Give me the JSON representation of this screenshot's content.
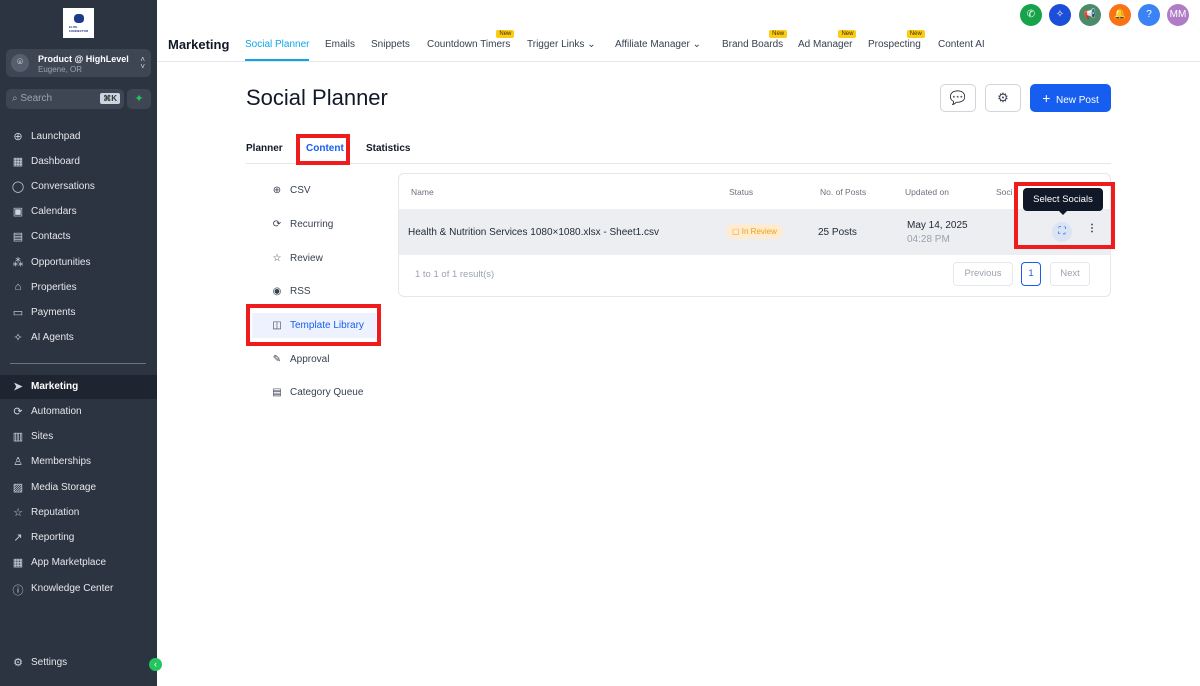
{
  "sidebar": {
    "logo": "ELITE CONNECTOR",
    "account_name": "Product @ HighLevel",
    "account_location": "Eugene, OR",
    "search_placeholder": "Search",
    "search_shortcut": "⌘K",
    "items": [
      {
        "label": "Launchpad"
      },
      {
        "label": "Dashboard"
      },
      {
        "label": "Conversations"
      },
      {
        "label": "Calendars"
      },
      {
        "label": "Contacts"
      },
      {
        "label": "Opportunities"
      },
      {
        "label": "Properties"
      },
      {
        "label": "Payments"
      },
      {
        "label": "AI Agents"
      },
      {
        "label": "Marketing"
      },
      {
        "label": "Automation"
      },
      {
        "label": "Sites"
      },
      {
        "label": "Memberships"
      },
      {
        "label": "Media Storage"
      },
      {
        "label": "Reputation"
      },
      {
        "label": "Reporting"
      },
      {
        "label": "App Marketplace"
      },
      {
        "label": "Knowledge Center"
      }
    ],
    "settings": "Settings"
  },
  "topnav": {
    "section": "Marketing",
    "tabs": [
      {
        "label": "Social Planner"
      },
      {
        "label": "Emails"
      },
      {
        "label": "Snippets"
      },
      {
        "label": "Countdown Timers",
        "badge": "New"
      },
      {
        "label": "Trigger Links"
      },
      {
        "label": "Affiliate Manager"
      },
      {
        "label": "Brand Boards",
        "badge": "New"
      },
      {
        "label": "Ad Manager",
        "badge": "New"
      },
      {
        "label": "Prospecting",
        "badge": "New"
      },
      {
        "label": "Content AI"
      }
    ],
    "avatar": "MM",
    "help": "?"
  },
  "page": {
    "title": "Social Planner",
    "new_post": "New Post",
    "tabs": [
      "Planner",
      "Content",
      "Statistics"
    ],
    "submenu": [
      "CSV",
      "Recurring",
      "Review",
      "RSS",
      "Template Library",
      "Approval",
      "Category Queue"
    ]
  },
  "table": {
    "columns": [
      "Name",
      "Status",
      "No. of Posts",
      "Updated on",
      "Soci"
    ],
    "rows": [
      {
        "name": "Health & Nutrition Services 1080×1080.xlsx - Sheet1.csv",
        "status": "In Review",
        "posts": "25 Posts",
        "date": "May 14, 2025",
        "time": "04:28 PM"
      }
    ],
    "summary": "1 to 1 of 1 result(s)",
    "previous": "Previous",
    "page": "1",
    "next": "Next",
    "tooltip": "Select Socials"
  },
  "colors": {
    "accent": "#155eef",
    "sidebar": "#2d3441",
    "highlight": "#ee1c1c"
  }
}
